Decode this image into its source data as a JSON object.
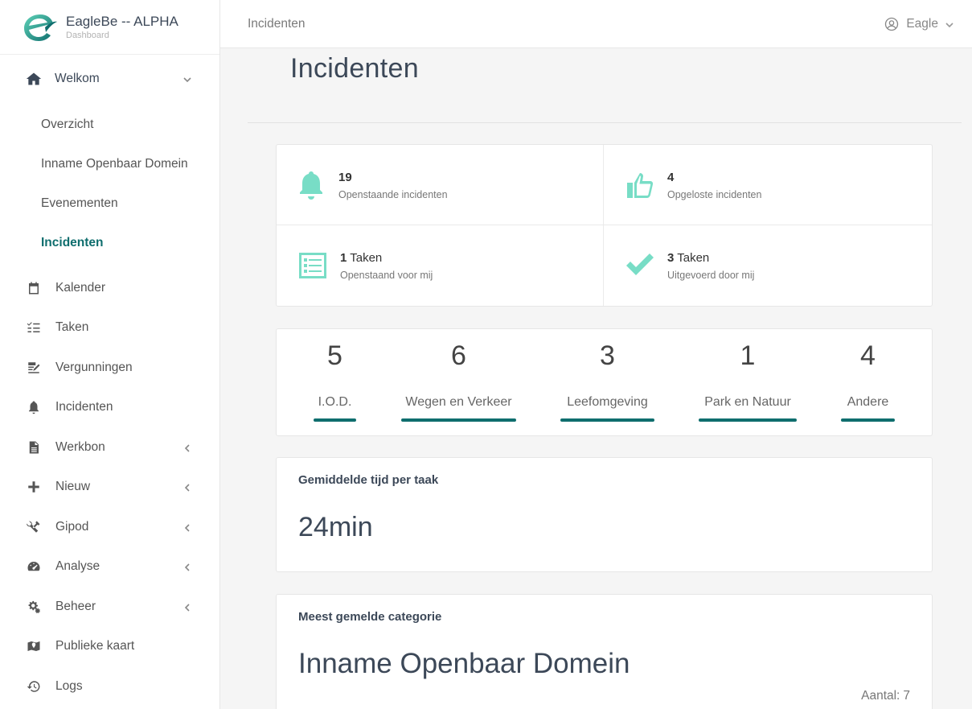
{
  "brand": {
    "title": "EagleBe -- ALPHA",
    "subtitle": "Dashboard"
  },
  "sidebar": {
    "top": {
      "label": "Welkom",
      "icon": "home-icon"
    },
    "subitems": [
      {
        "label": "Overzicht",
        "active": false
      },
      {
        "label": "Inname Openbaar Domein",
        "active": false
      },
      {
        "label": "Evenementen",
        "active": false
      },
      {
        "label": "Incidenten",
        "active": true
      }
    ],
    "items": [
      {
        "label": "Kalender",
        "icon": "calendar-icon",
        "chevron": false
      },
      {
        "label": "Taken",
        "icon": "tasks-icon",
        "chevron": false
      },
      {
        "label": "Vergunningen",
        "icon": "license-icon",
        "chevron": false
      },
      {
        "label": "Incidenten",
        "icon": "bell-icon",
        "chevron": false
      },
      {
        "label": "Werkbon",
        "icon": "document-icon",
        "chevron": true
      },
      {
        "label": "Nieuw",
        "icon": "plus-icon",
        "chevron": true
      },
      {
        "label": "Gipod",
        "icon": "tools-icon",
        "chevron": true
      },
      {
        "label": "Analyse",
        "icon": "gauge-icon",
        "chevron": true
      },
      {
        "label": "Beheer",
        "icon": "gears-icon",
        "chevron": true
      },
      {
        "label": "Publieke kaart",
        "icon": "map-icon",
        "chevron": false
      },
      {
        "label": "Logs",
        "icon": "history-icon",
        "chevron": false
      }
    ]
  },
  "topbar": {
    "breadcrumb": "Incidenten",
    "user": "Eagle"
  },
  "page": {
    "title": "Incidenten"
  },
  "stats": {
    "open_incidents": {
      "value": "19",
      "label": "Openstaande incidenten"
    },
    "solved_incidents": {
      "value": "4",
      "label": "Opgeloste incidenten"
    },
    "open_tasks": {
      "value": "1",
      "unit": "Taken",
      "label": "Openstaand voor mij"
    },
    "done_tasks": {
      "value": "3",
      "unit": "Taken",
      "label": "Uitgevoerd door mij"
    }
  },
  "categories": [
    {
      "value": "5",
      "label": "I.O.D."
    },
    {
      "value": "6",
      "label": "Wegen en Verkeer"
    },
    {
      "value": "3",
      "label": "Leefomgeving"
    },
    {
      "value": "1",
      "label": "Park en Natuur"
    },
    {
      "value": "4",
      "label": "Andere"
    }
  ],
  "avg_time": {
    "title": "Gemiddelde tijd per taak",
    "value": "24min"
  },
  "most_reported": {
    "title": "Meest gemelde categorie",
    "value": "Inname Openbaar Domein",
    "count_label": "Aantal:",
    "count": "7"
  },
  "colors": {
    "accent": "#0f6e6e",
    "icon_mint": "#78ddc6"
  }
}
